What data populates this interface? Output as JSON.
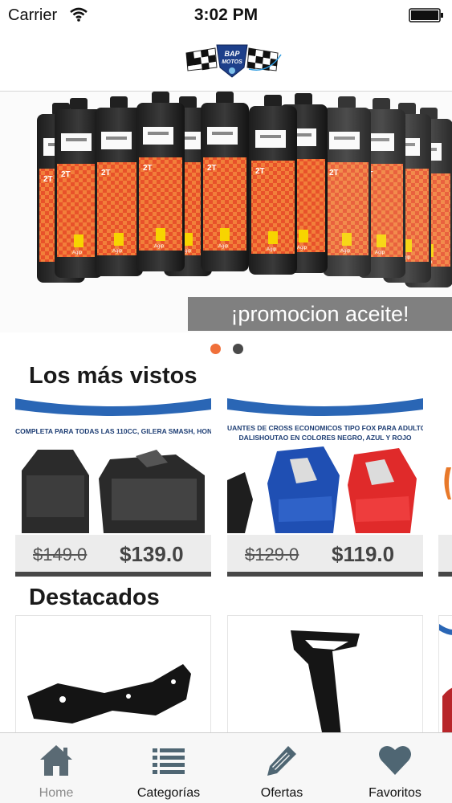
{
  "status_bar": {
    "carrier": "Carrier",
    "time": "3:02 PM"
  },
  "header": {
    "logo_text": "BAP MOTOS"
  },
  "carousel": {
    "caption": "¡promocion aceite!",
    "bottle_label": "2T",
    "brand": "Agip",
    "slide_count": 2,
    "active_slide": 1
  },
  "sections": {
    "most_viewed_title": "Los más vistos",
    "featured_title": "Destacados"
  },
  "most_viewed": [
    {
      "banner": "COMPLETA PARA TODAS LAS 110CC, GILERA SMASH, HON",
      "old_price": "$149.0",
      "price": "$139.0"
    },
    {
      "banner": "UANTES DE CROSS ECONOMICOS TIPO FOX PARA ADULTO",
      "banner_2": "DALISHOUTAO EN COLORES NEGRO, AZUL Y ROJO",
      "old_price": "$129.0",
      "price": "$119.0"
    }
  ],
  "tabs": [
    {
      "label": "Home",
      "icon": "home-icon",
      "active": true
    },
    {
      "label": "Categorías",
      "icon": "list-icon",
      "active": false
    },
    {
      "label": "Ofertas",
      "icon": "pencil-icon",
      "active": false
    },
    {
      "label": "Favoritos",
      "icon": "heart-icon",
      "active": false
    }
  ],
  "colors": {
    "accent": "#f0703a",
    "tab_icon": "#4f6673",
    "price": "#444444",
    "banner_blue": "#2a66b5"
  }
}
